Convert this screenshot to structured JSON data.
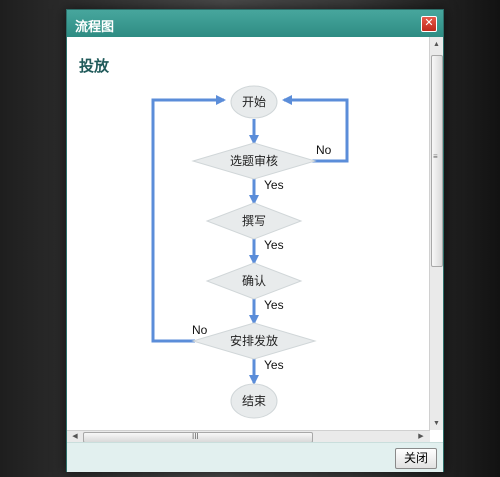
{
  "dialog": {
    "title": "流程图",
    "close_icon": "close-icon",
    "heading": "投放",
    "footer_button": "关闭"
  },
  "flowchart": {
    "nodes": {
      "start": "开始",
      "topic_review": "选题审核",
      "write": "撰写",
      "confirm": "确认",
      "arrange_release": "安排发放",
      "end": "结束"
    },
    "edge_labels": {
      "yes1": "Yes",
      "yes2": "Yes",
      "yes3": "Yes",
      "yes4": "Yes",
      "no_review": "No",
      "no_release": "No"
    },
    "colors": {
      "arrow": "#5b8dd9",
      "node_fill": "#e8ebec",
      "node_stroke": "#d0d6d8"
    }
  },
  "scrollbars": {
    "vertical_grip": "≡",
    "horizontal_grip": "III"
  }
}
